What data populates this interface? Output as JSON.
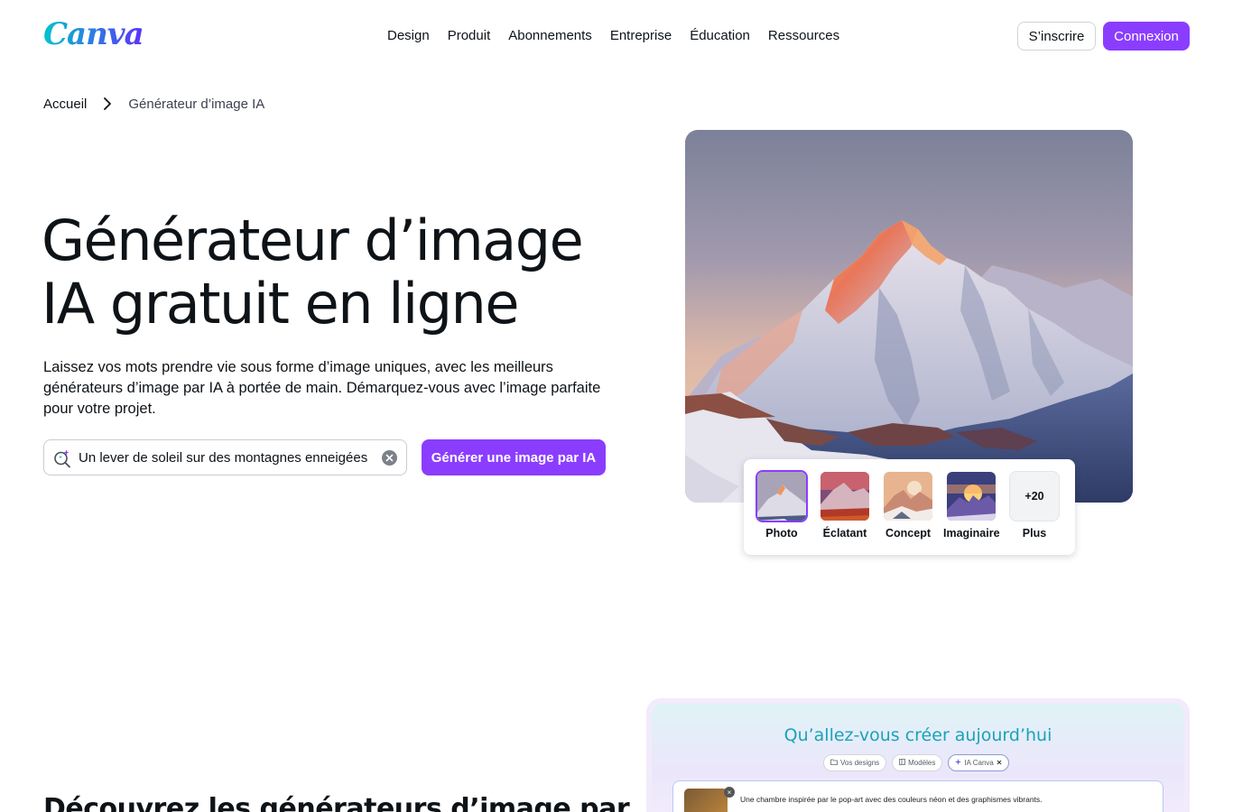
{
  "header": {
    "logo": "Canva",
    "nav": [
      "Design",
      "Produit",
      "Abonnements",
      "Entreprise",
      "Éducation",
      "Ressources"
    ],
    "signup_label": "S’inscrire",
    "login_label": "Connexion"
  },
  "breadcrumb": {
    "home": "Accueil",
    "current": "Générateur d’image IA"
  },
  "hero": {
    "title_line1": "Générateur d’image",
    "title_line2": "IA gratuit en ligne",
    "description": "Laissez vos mots prendre vie sous forme d’image uniques, avec les meilleurs générateurs d’image par IA à portée de main. Démarquez-vous avec l’image parfaite pour votre projet.",
    "search_value": "Un lever de soleil sur des montagnes enneigées",
    "generate_label": "Générer une image par IA"
  },
  "styles": {
    "items": [
      {
        "label": "Photo",
        "selected": true
      },
      {
        "label": "Éclatant",
        "selected": false
      },
      {
        "label": "Concept",
        "selected": false
      },
      {
        "label": "Imaginaire",
        "selected": false
      }
    ],
    "more_count": "+20",
    "more_label": "Plus"
  },
  "section2": {
    "title": "Découvrez les générateurs d’image par"
  },
  "preview": {
    "title": "Qu’allez-vous créer aujourd’hui",
    "chips": [
      "Vos designs",
      "Modèles",
      "IA Canva"
    ],
    "prompt_text": "Une chambre inspirée par le pop-art avec des couleurs néon et des graphismes vibrants."
  },
  "colors": {
    "accent": "#8b3dff",
    "text": "#0e1318",
    "preview_title": "#1aa3b8"
  }
}
